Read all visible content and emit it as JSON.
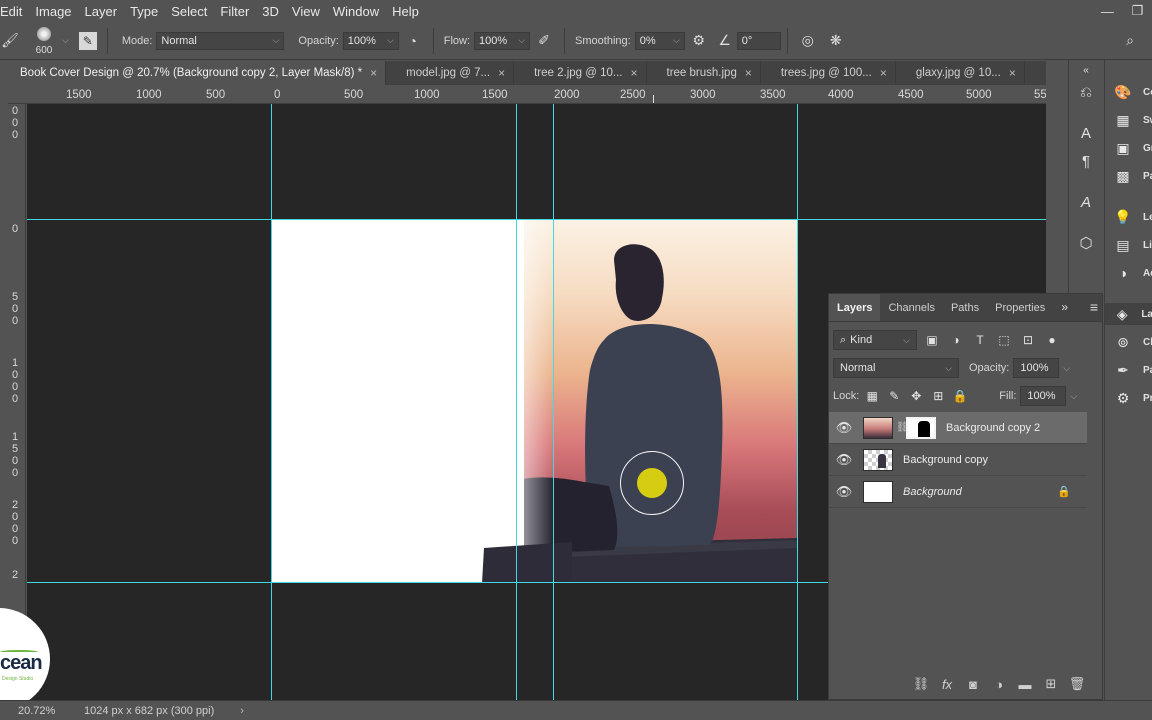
{
  "menu": [
    "Edit",
    "Image",
    "Layer",
    "Type",
    "Select",
    "Filter",
    "3D",
    "View",
    "Window",
    "Help"
  ],
  "window_controls": {
    "minimize": "—",
    "restore": "❐"
  },
  "options": {
    "brush_size": "600",
    "mode_label": "Mode:",
    "mode_value": "Normal",
    "opacity_label": "Opacity:",
    "opacity_value": "100%",
    "flow_label": "Flow:",
    "flow_value": "100%",
    "smoothing_label": "Smoothing:",
    "smoothing_value": "0%",
    "angle_value": "0°"
  },
  "tabs": [
    {
      "label": "Book Cover Design @ 20.7% (Background copy 2, Layer Mask/8) *",
      "active": true
    },
    {
      "label": "model.jpg @ 7..."
    },
    {
      "label": "tree 2.jpg @ 10..."
    },
    {
      "label": "tree brush.jpg"
    },
    {
      "label": "trees.jpg @ 100..."
    },
    {
      "label": "glaxy.jpg @ 10..."
    }
  ],
  "ruler": {
    "top": [
      "1500",
      "1000",
      "500",
      "0",
      "500",
      "1000",
      "1500",
      "2000",
      "2500",
      "3000",
      "3500",
      "4000",
      "4500",
      "5000",
      "55"
    ],
    "left_groups": [
      [
        "0",
        "0",
        "0"
      ],
      [
        "0"
      ],
      [
        "5",
        "0",
        "0"
      ],
      [
        "1",
        "0",
        "0",
        "0"
      ],
      [
        "1",
        "5",
        "0",
        "0"
      ],
      [
        "2",
        "0",
        "0",
        "0"
      ],
      [
        "2"
      ]
    ]
  },
  "layers_panel": {
    "tabs": [
      "Layers",
      "Channels",
      "Paths",
      "Properties"
    ],
    "kind_label": "Kind",
    "blend_mode": "Normal",
    "opacity_label": "Opacity:",
    "opacity_value": "100%",
    "lock_label": "Lock:",
    "fill_label": "Fill:",
    "fill_value": "100%",
    "layers": [
      {
        "name": "Background copy 2",
        "selected": true,
        "has_mask": true
      },
      {
        "name": "Background copy",
        "selected": false
      },
      {
        "name": "Background",
        "selected": false,
        "locked": true
      }
    ]
  },
  "right_panel_labels": [
    "Co",
    "Sw",
    "Gr",
    "Pa",
    "Le",
    "Lib",
    "Ad",
    "La",
    "Ch",
    "Pa",
    "Pr"
  ],
  "status": {
    "zoom": "20.72%",
    "doc_size": "1024 px x 682 px (300 ppi)"
  },
  "logo_text": "cean",
  "logo_subtext": "Design Studio"
}
